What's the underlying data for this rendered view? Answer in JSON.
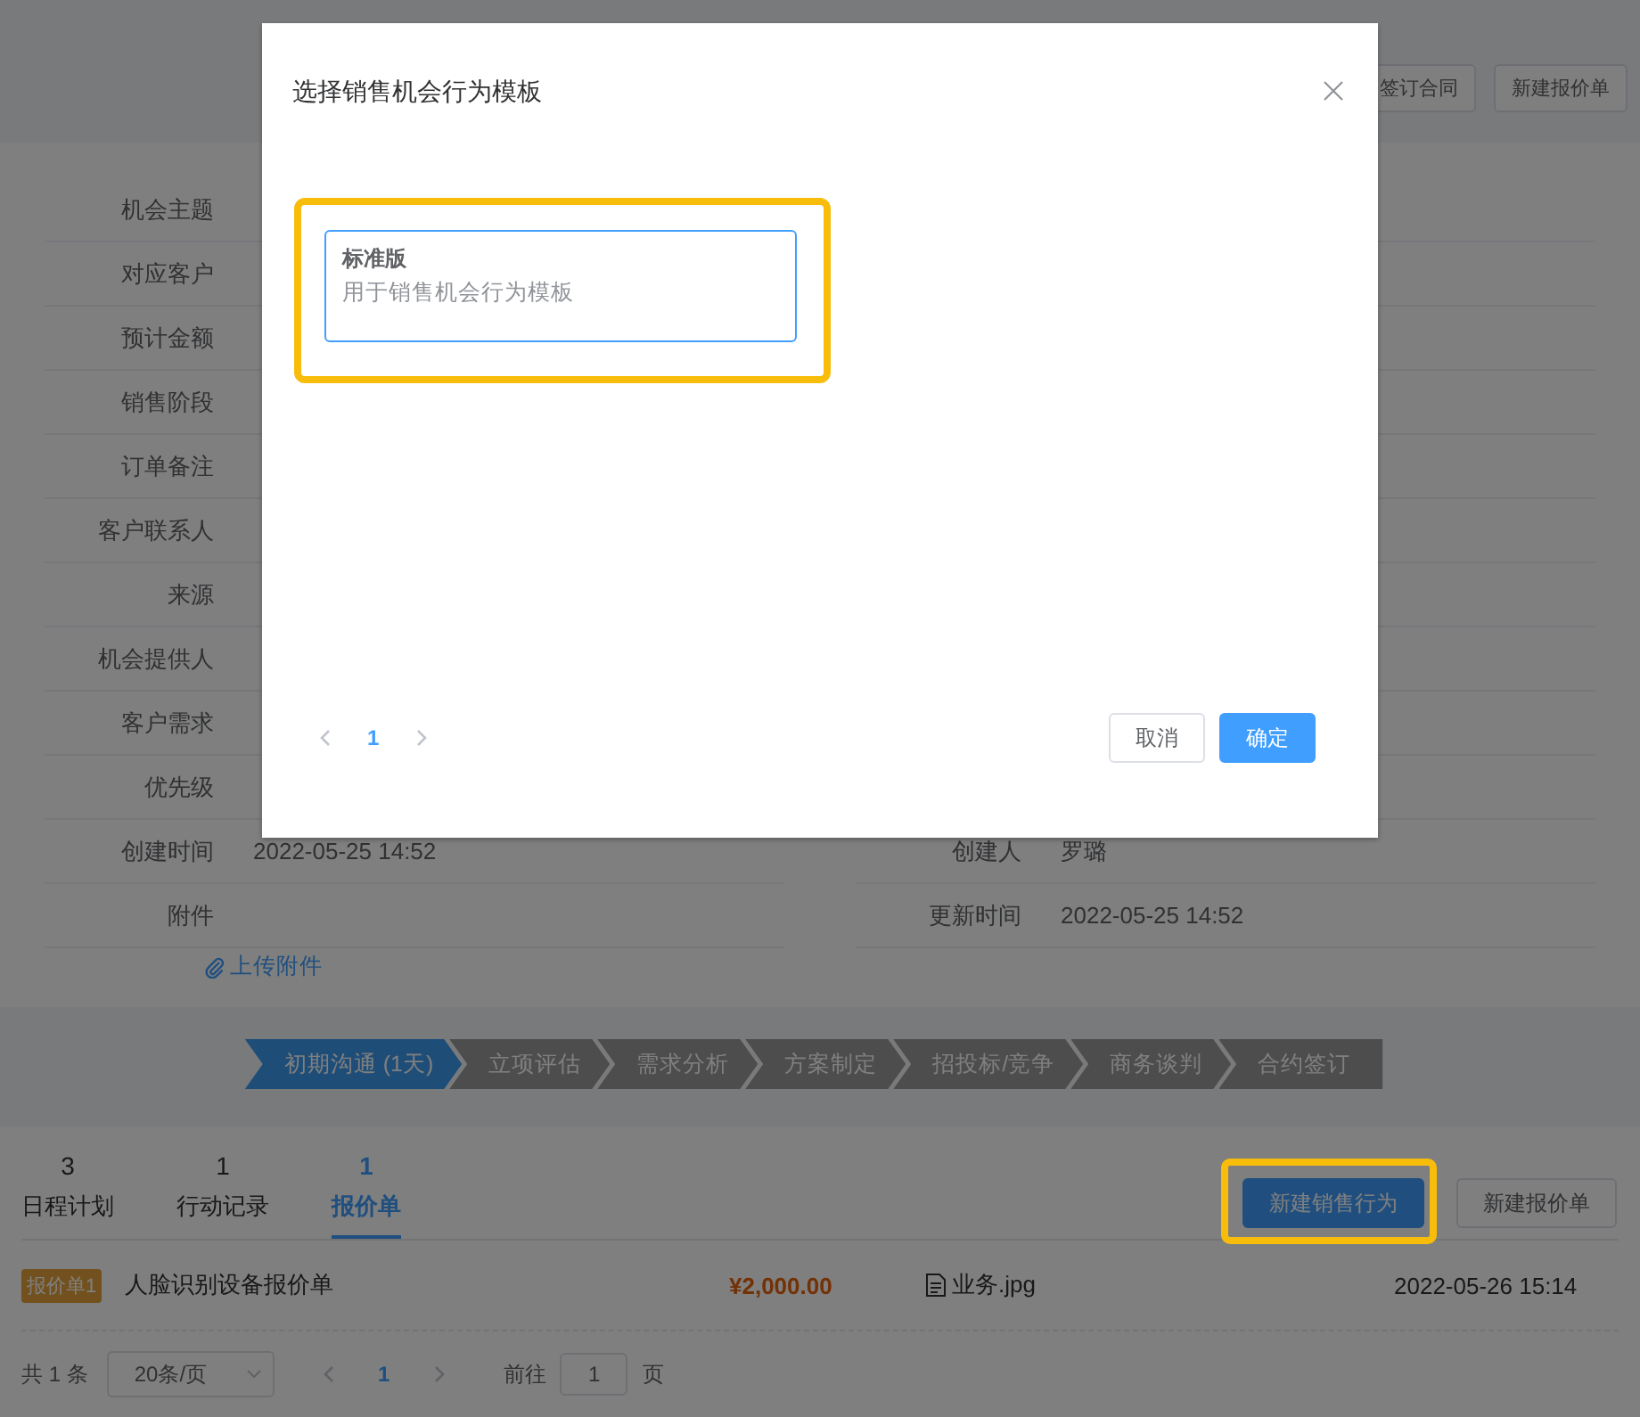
{
  "header": {
    "buttons": [
      "签订合同",
      "新建报价单"
    ]
  },
  "details": {
    "left": [
      {
        "label": "机会主题"
      },
      {
        "label": "对应客户"
      },
      {
        "label": "预计金额"
      },
      {
        "label": "销售阶段"
      },
      {
        "label": "订单备注"
      },
      {
        "label": "客户联系人"
      },
      {
        "label": "来源"
      },
      {
        "label": "机会提供人"
      },
      {
        "label": "客户需求"
      },
      {
        "label": "优先级"
      },
      {
        "label": "创建时间",
        "value": "2022-05-25 14:52"
      },
      {
        "label": "附件"
      }
    ],
    "right": [
      {
        "label": "创建人",
        "value": "罗璐"
      },
      {
        "label": "更新时间",
        "value": "2022-05-25 14:52"
      }
    ],
    "upload_link": "上传附件"
  },
  "stages": [
    {
      "label": "初期沟通 (1天)",
      "selected": true
    },
    {
      "label": "立项评估",
      "selected": false
    },
    {
      "label": "需求分析",
      "selected": false
    },
    {
      "label": "方案制定",
      "selected": false
    },
    {
      "label": "招投标/竞争",
      "selected": false
    },
    {
      "label": "商务谈判",
      "selected": false
    },
    {
      "label": "合约签订",
      "selected": false
    }
  ],
  "records": {
    "tabs": [
      {
        "count": "3",
        "label": "日程计划",
        "selected": false
      },
      {
        "count": "1",
        "label": "行动记录",
        "selected": false
      },
      {
        "count": "1",
        "label": "报价单",
        "selected": true
      }
    ],
    "buttons": [
      {
        "label": "新建销售行为",
        "kind": "primary",
        "highlighted": true
      },
      {
        "label": "新建报价单",
        "kind": "default",
        "highlighted": false
      }
    ],
    "rows": [
      {
        "tag": "报价单1",
        "title": "人脸识别设备报价单",
        "amount": "¥2,000.00",
        "file": "业务.jpg",
        "time": "2022-05-26 15:14"
      }
    ],
    "pagination": {
      "total": "共 1 条",
      "page_size": "20条/页",
      "pages": [
        {
          "label": "1",
          "selected": true
        }
      ],
      "goto_label": "前往",
      "goto_value": "1",
      "goto_suffix": "页"
    }
  },
  "modal": {
    "title": "选择销售机会行为模板",
    "templates": [
      {
        "name": "标准版",
        "description": "用于销售机会行为模板",
        "selected": true,
        "highlighted": true
      }
    ],
    "pages": [
      {
        "label": "1",
        "selected": true
      }
    ],
    "buttons": [
      {
        "label": "取消",
        "kind": "default"
      },
      {
        "label": "确定",
        "kind": "primary"
      }
    ]
  }
}
